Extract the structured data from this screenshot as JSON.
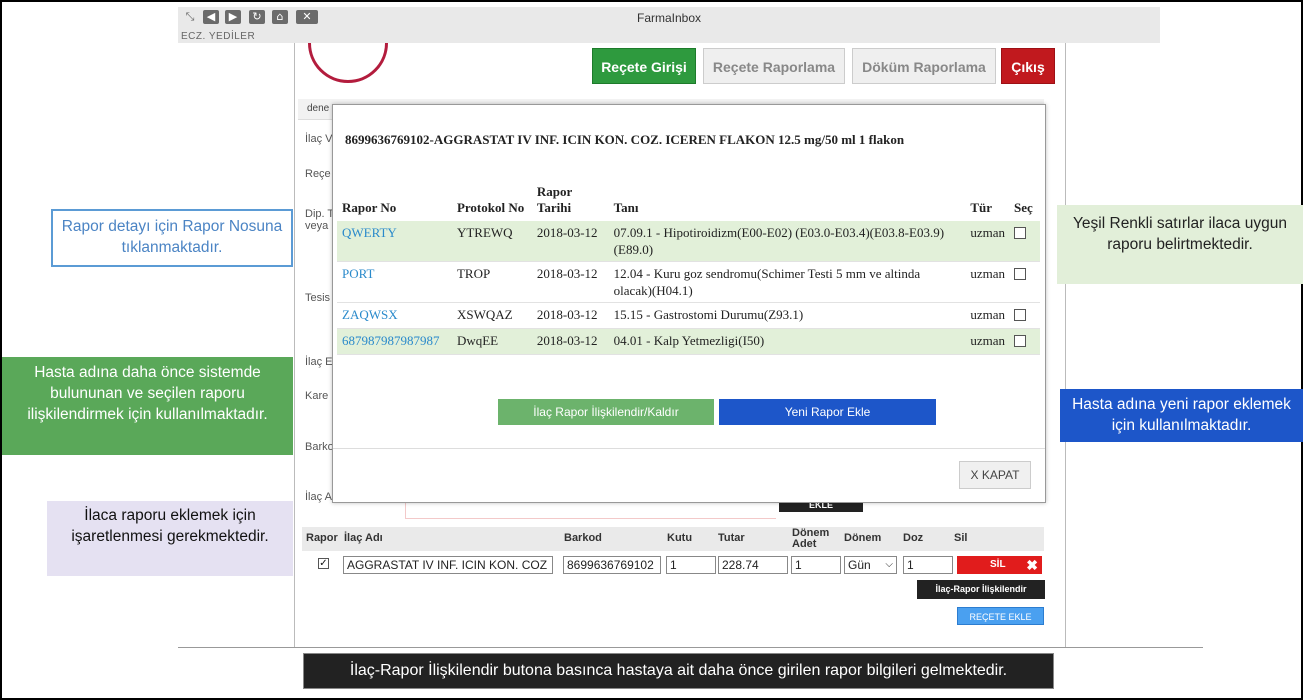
{
  "window": {
    "title": "FarmaInbox",
    "user": "ECZ. YEDİLER"
  },
  "nav": {
    "recete_girisi": "Reçete Girişi",
    "recete_raporlama": "Reçete Raporlama",
    "dokum_raporlama": "Döküm Raporlama",
    "cikis": "Çıkış"
  },
  "breadcrumb": "dene",
  "side_labels": [
    "İlaç V",
    "Reçe",
    "Dip. T",
    "veya",
    "Tesis",
    "İlaç E",
    "Kare",
    "Barko",
    "İlaç A"
  ],
  "modal": {
    "title": "8699636769102-AGGRASTAT IV INF. ICIN KON. COZ. ICEREN FLAKON 12.5 mg/50 ml 1 flakon",
    "columns": {
      "rapor_no": "Rapor No",
      "protokol_no": "Protokol No",
      "rapor_tarihi": "Rapor Tarihi",
      "tani": "Tanı",
      "tur": "Tür",
      "sec": "Seç"
    },
    "rows": [
      {
        "rapor_no": "QWERTY",
        "protokol_no": "YTREWQ",
        "tarih": "2018-03-12",
        "tani": "07.09.1 - Hipotiroidizm(E00-E02) (E03.0-E03.4)(E03.8-E03.9)(E89.0)",
        "tur": "uzman",
        "highlighted": true
      },
      {
        "rapor_no": "PORT",
        "protokol_no": "TROP",
        "tarih": "2018-03-12",
        "tani": "12.04 - Kuru goz sendromu(Schimer Testi 5 mm ve altinda olacak)(H04.1)",
        "tur": "uzman",
        "highlighted": false
      },
      {
        "rapor_no": "ZAQWSX",
        "protokol_no": "XSWQAZ",
        "tarih": "2018-03-12",
        "tani": "15.15 - Gastrostomi Durumu(Z93.1)",
        "tur": "uzman",
        "highlighted": false
      },
      {
        "rapor_no": "687987987987987",
        "protokol_no": "DwqEE",
        "tarih": "2018-03-12",
        "tani": "04.01 - Kalp Yetmezligi(I50)",
        "tur": "uzman",
        "highlighted": true
      }
    ],
    "btn_iliskilendir": "İlaç Rapor İlişkilendir/Kaldır",
    "btn_yeni_rapor": "Yeni Rapor Ekle",
    "btn_kapat": "X KAPAT"
  },
  "ekle_button": "EKLE",
  "drug_table": {
    "headers": {
      "rapor": "Rapor",
      "ilac_adi": "İlaç Adı",
      "barkod": "Barkod",
      "kutu": "Kutu",
      "tutar": "Tutar",
      "donem_adet": "Dönem Adet",
      "donem": "Dönem",
      "doz": "Doz",
      "sil": "Sil"
    },
    "row": {
      "ilac_adi": "AGGRASTAT IV INF. ICIN KON. COZ",
      "barkod": "8699636769102",
      "kutu": "1",
      "tutar": "228.74",
      "donem_adet": "1",
      "donem": "Gün",
      "doz": "1",
      "sil": "SİL"
    },
    "btn_ilac_rapor": "İlaç-Rapor İlişkilendir",
    "btn_recete_ekle": "REÇETE EKLE"
  },
  "annotations": {
    "rapor_detay": "Rapor detayı için Rapor Nosuna tıklanmaktadır.",
    "yesil": "Yeşil Renkli satırlar ilaca uygun raporu belirtmektedir.",
    "hasta_adina": "Hasta adına daha önce sistemde bulununan ve seçilen raporu ilişkilendirmek için kullanılmaktadır.",
    "yeni_rapor": "Hasta adına yeni rapor eklemek için kullanılmaktadır.",
    "ilaca_raporu": "İlaca raporu eklemek için işaretlenmesi gerekmektedir.",
    "bottom": "İlaç-Rapor İlişkilendir butona basınca hastaya ait daha önce girilen rapor bilgileri gelmektedir."
  },
  "colors": {
    "green_row": "#e2f0d9",
    "link_blue": "#2a8acb",
    "primary_green": "#2e9a3e",
    "danger_red": "#c1191e",
    "accent_blue": "#1d56c9"
  }
}
